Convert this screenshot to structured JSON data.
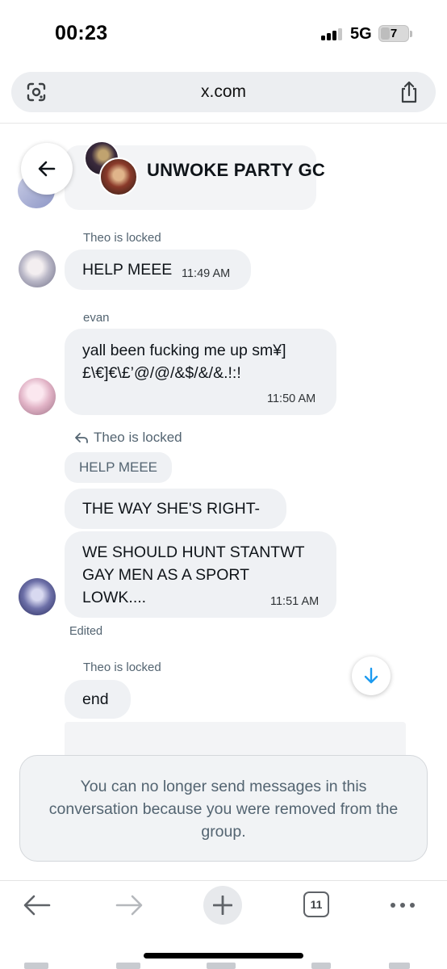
{
  "status_bar": {
    "time": "00:23",
    "network": "5G",
    "battery": "7"
  },
  "browser": {
    "url": "x.com",
    "tab_count": "11"
  },
  "chat": {
    "title": "UNWOKE PARTY GC",
    "messages": [
      {
        "sender": "Theo is locked",
        "text": "HELP MEEE",
        "time": "11:49 AM"
      },
      {
        "sender": "evan",
        "text_line1": "yall been fucking me up sm¥]",
        "text_line2": "£\\€]€\\£’@/@/&$/&/&.!:!",
        "time": "11:50 AM"
      },
      {
        "reply_to_sender": "Theo is locked",
        "reply_quote": "HELP MEEE",
        "text": "THE WAY SHE'S RIGHT-",
        "followup_line1": "WE SHOULD HUNT STANTWT",
        "followup_line2": "GAY MEN AS A SPORT",
        "followup_line3": "LOWK....",
        "time": "11:51 AM",
        "status": "Edited"
      },
      {
        "sender": "Theo is locked",
        "text": "end"
      }
    ],
    "removed_notice": "You can no longer send messages in this conversation because you were removed from the group."
  },
  "icons": {
    "back": "arrow-left-icon",
    "scroll_down": "arrow-down-icon",
    "lens": "google-lens-icon",
    "share": "share-icon",
    "reply": "reply-icon",
    "nav_back": "arrow-left-icon",
    "nav_forward": "arrow-right-icon",
    "new_tab": "plus-icon",
    "more": "more-dots-icon"
  },
  "colors": {
    "bubble": "#eff1f4",
    "secondary_text": "#536471",
    "accent": "#1d9bf0"
  }
}
